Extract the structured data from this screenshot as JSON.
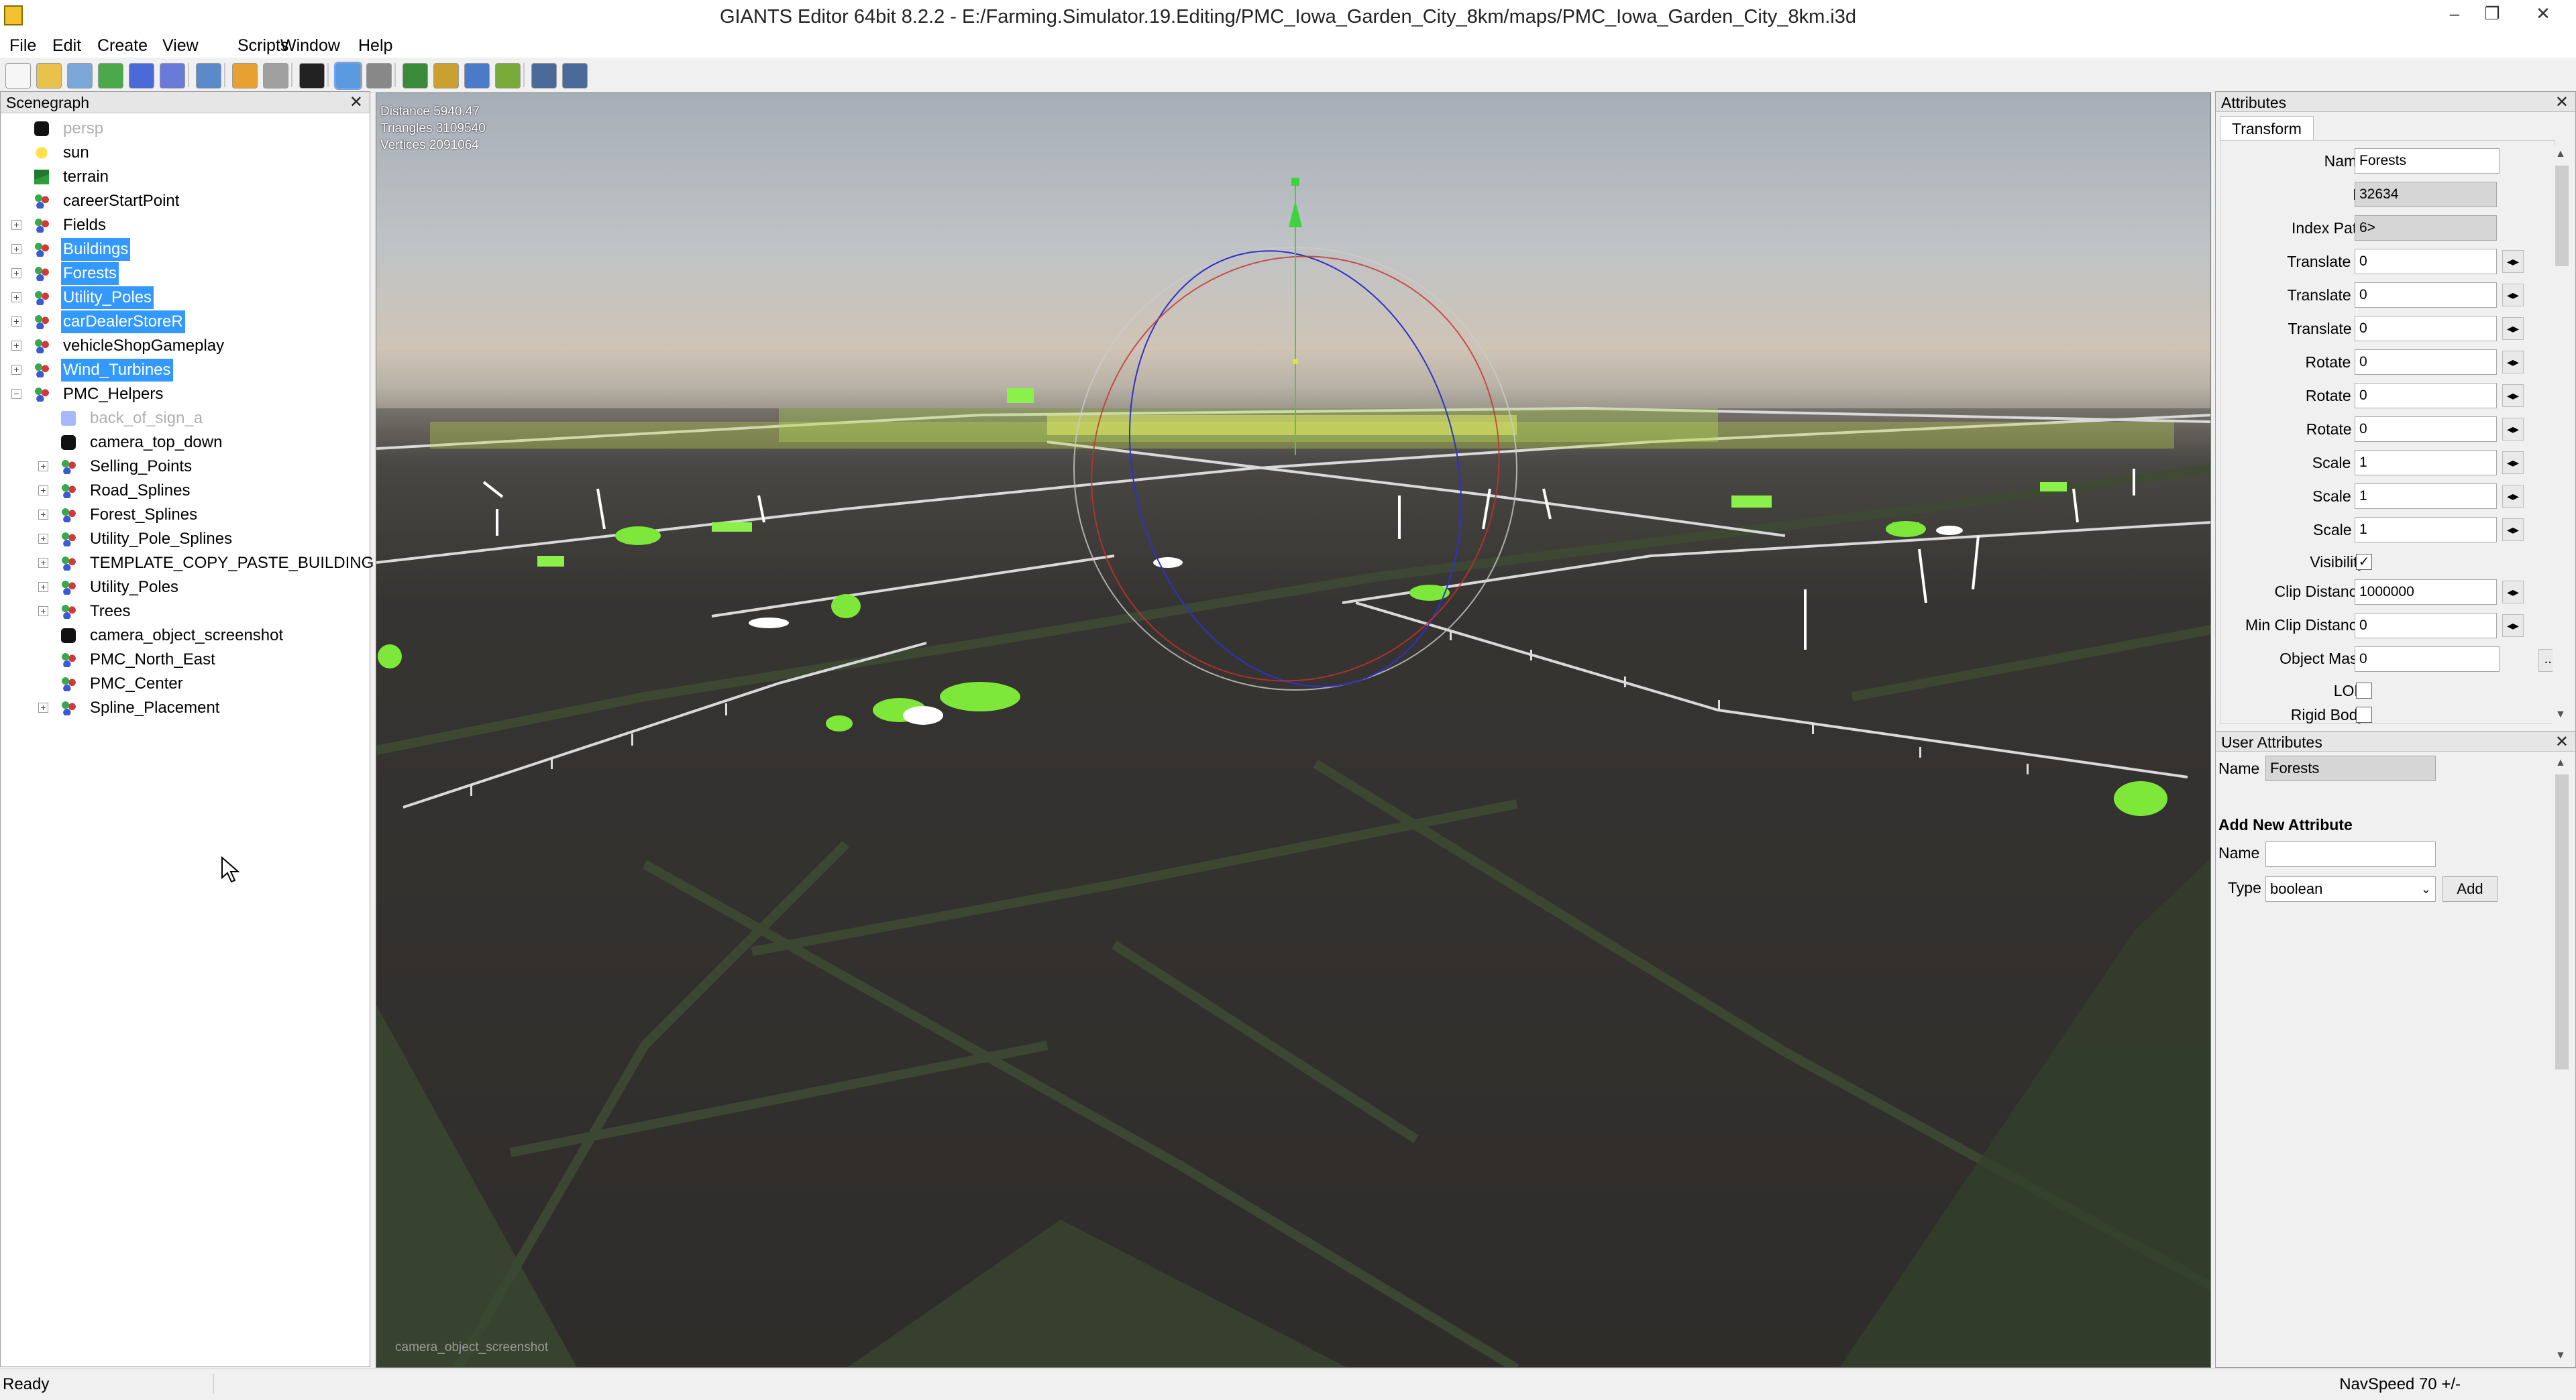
{
  "window": {
    "title": "GIANTS Editor 64bit 8.2.2 - E:/Farming.Simulator.19.Editing/PMC_Iowa_Garden_City_8km/maps/PMC_Iowa_Garden_City_8km.i3d",
    "minimize": "–",
    "maximize": "❐",
    "close": "✕"
  },
  "menu": [
    "File",
    "Edit",
    "Create",
    "View",
    "Scripts",
    "Window",
    "Help"
  ],
  "toolbar": {
    "icons": [
      "new-file-icon",
      "open-file-icon",
      "edit-icon",
      "refresh-icon",
      "save-icon",
      "save-as-icon",
      "import-icon",
      "undo-icon",
      "redo-icon",
      "play-icon",
      "select-mode-icon",
      "magnet-icon",
      "terrain-paint-icon",
      "terrain-sculpt-icon",
      "foliage-paint-icon",
      "vegetation-icon",
      "settings-icon",
      "plugins-icon"
    ]
  },
  "scenegraph": {
    "title": "Scenegraph",
    "close": "✕",
    "items": [
      {
        "label": "persp",
        "level": 1,
        "icon": "camera-icon",
        "expander": "",
        "selected": false,
        "dim": true
      },
      {
        "label": "sun",
        "level": 1,
        "icon": "light-icon",
        "expander": "",
        "selected": false,
        "dim": false
      },
      {
        "label": "terrain",
        "level": 1,
        "icon": "terrain-icon",
        "expander": "",
        "selected": false,
        "dim": false
      },
      {
        "label": "careerStartPoint",
        "level": 1,
        "icon": "transform-group-icon",
        "expander": "",
        "selected": false,
        "dim": false
      },
      {
        "label": "Fields",
        "level": 1,
        "icon": "transform-group-icon",
        "expander": "+",
        "selected": false,
        "dim": false
      },
      {
        "label": "Buildings",
        "level": 1,
        "icon": "transform-group-icon",
        "expander": "+",
        "selected": true,
        "dim": false
      },
      {
        "label": "Forests",
        "level": 1,
        "icon": "transform-group-icon",
        "expander": "+",
        "selected": true,
        "dim": false
      },
      {
        "label": "Utility_Poles",
        "level": 1,
        "icon": "transform-group-icon",
        "expander": "+",
        "selected": true,
        "dim": false
      },
      {
        "label": "carDealerStoreR",
        "level": 1,
        "icon": "transform-group-icon",
        "expander": "+",
        "selected": true,
        "dim": false
      },
      {
        "label": "vehicleShopGameplay",
        "level": 1,
        "icon": "transform-group-icon",
        "expander": "+",
        "selected": false,
        "dim": false
      },
      {
        "label": "Wind_Turbines",
        "level": 1,
        "icon": "transform-group-icon",
        "expander": "+",
        "selected": true,
        "dim": false
      },
      {
        "label": "PMC_Helpers",
        "level": 1,
        "icon": "transform-group-icon",
        "expander": "−",
        "selected": false,
        "dim": false
      },
      {
        "label": "back_of_sign_a",
        "level": 2,
        "icon": "shape-icon",
        "expander": "",
        "selected": false,
        "dim": true
      },
      {
        "label": "camera_top_down",
        "level": 2,
        "icon": "camera-icon",
        "expander": "",
        "selected": false,
        "dim": false
      },
      {
        "label": "Selling_Points",
        "level": 2,
        "icon": "transform-group-icon",
        "expander": "+",
        "selected": false,
        "dim": false
      },
      {
        "label": "Road_Splines",
        "level": 2,
        "icon": "transform-group-icon",
        "expander": "+",
        "selected": false,
        "dim": false
      },
      {
        "label": "Forest_Splines",
        "level": 2,
        "icon": "transform-group-icon",
        "expander": "+",
        "selected": false,
        "dim": false
      },
      {
        "label": "Utility_Pole_Splines",
        "level": 2,
        "icon": "transform-group-icon",
        "expander": "+",
        "selected": false,
        "dim": false
      },
      {
        "label": "TEMPLATE_COPY_PASTE_BUILDING",
        "level": 2,
        "icon": "transform-group-icon",
        "expander": "+",
        "selected": false,
        "dim": false
      },
      {
        "label": "Utility_Poles",
        "level": 2,
        "icon": "transform-group-icon",
        "expander": "+",
        "selected": false,
        "dim": false
      },
      {
        "label": "Trees",
        "level": 2,
        "icon": "transform-group-icon",
        "expander": "+",
        "selected": false,
        "dim": false
      },
      {
        "label": "camera_object_screenshot",
        "level": 2,
        "icon": "camera-icon",
        "expander": "",
        "selected": false,
        "dim": false
      },
      {
        "label": "PMC_North_East",
        "level": 2,
        "icon": "transform-group-icon",
        "expander": "",
        "selected": false,
        "dim": false
      },
      {
        "label": "PMC_Center",
        "level": 2,
        "icon": "transform-group-icon",
        "expander": "",
        "selected": false,
        "dim": false
      },
      {
        "label": "Spline_Placement",
        "level": 2,
        "icon": "transform-group-icon",
        "expander": "+",
        "selected": false,
        "dim": false
      }
    ]
  },
  "viewport": {
    "stats": [
      "Distance 5940.47",
      "Triangles 3109540",
      "Vertices 2091064"
    ],
    "camera_label": "camera_object_screenshot"
  },
  "attributes": {
    "title": "Attributes",
    "close": "✕",
    "tab": "Transform",
    "fields": [
      {
        "label": "Name",
        "value": "Forests",
        "readonly": false,
        "spin": false
      },
      {
        "label": "Id",
        "value": "32634",
        "readonly": true,
        "spin": false
      },
      {
        "label": "Index Path",
        "value": "6>",
        "readonly": true,
        "spin": false
      },
      {
        "label": "Translate X",
        "value": "0",
        "readonly": false,
        "spin": true
      },
      {
        "label": "Translate Y",
        "value": "0",
        "readonly": false,
        "spin": true
      },
      {
        "label": "Translate Z",
        "value": "0",
        "readonly": false,
        "spin": true
      },
      {
        "label": "Rotate X",
        "value": "0",
        "readonly": false,
        "spin": true
      },
      {
        "label": "Rotate Y",
        "value": "0",
        "readonly": false,
        "spin": true
      },
      {
        "label": "Rotate Z",
        "value": "0",
        "readonly": false,
        "spin": true
      },
      {
        "label": "Scale X",
        "value": "1",
        "readonly": false,
        "spin": true
      },
      {
        "label": "Scale Y",
        "value": "1",
        "readonly": false,
        "spin": true
      },
      {
        "label": "Scale Z",
        "value": "1",
        "readonly": false,
        "spin": true
      }
    ],
    "visibility_label": "Visibility",
    "visibility_checked": "✓",
    "clip_distance_label": "Clip Distance",
    "clip_distance": "1000000",
    "min_clip_distance_label": "Min Clip Distance",
    "min_clip_distance": "0",
    "object_mask_label": "Object Mask",
    "object_mask": "0",
    "object_mask_button": "...",
    "lod_label": "LOD",
    "rigid_body_label": "Rigid Body",
    "spin_glyph": "◂▸"
  },
  "user_attributes": {
    "title": "User Attributes",
    "close": "✕",
    "name_label": "Name",
    "name_value": "Forests",
    "add_new_title": "Add New Attribute",
    "new_name_label": "Name",
    "new_name_value": "",
    "type_label": "Type",
    "type_value": "boolean",
    "add_button": "Add"
  },
  "statusbar": {
    "status": "Ready",
    "navspeed": "NavSpeed 70 +/-"
  }
}
